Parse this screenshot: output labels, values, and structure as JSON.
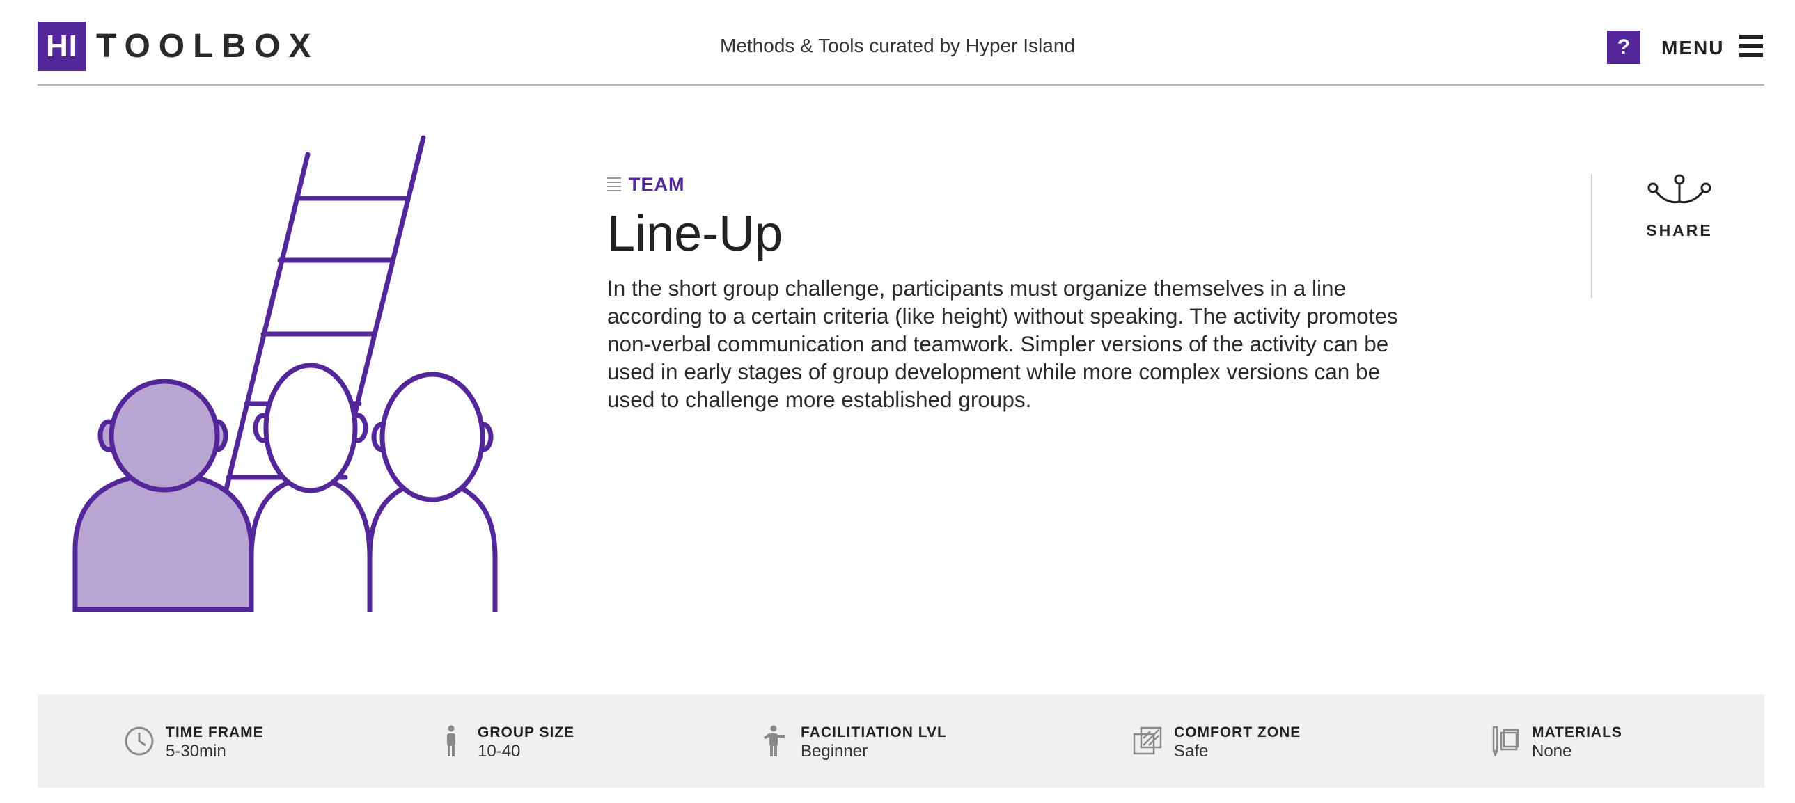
{
  "header": {
    "logo_mark": "HI",
    "logo_text": "TOOLBOX",
    "tagline": "Methods & Tools curated by Hyper Island",
    "help_label": "?",
    "menu_label": "MENU"
  },
  "colors": {
    "brand": "#53269a",
    "brand_light": "#b8a5d1",
    "infobar_bg": "#eff0ef"
  },
  "method": {
    "category": "TEAM",
    "title": "Line-Up",
    "description": "In the short group challenge, participants must organize themselves in a line according to a certain criteria (like height) without speaking. The activity promotes non-verbal communication and teamwork. Simpler versions of the activity can be used in early stages of group development while more complex versions can be used to challenge more established groups."
  },
  "share": {
    "label": "SHARE",
    "icon": "share-icon"
  },
  "info": [
    {
      "icon": "clock-icon",
      "label": "TIME FRAME",
      "value": "5-30min"
    },
    {
      "icon": "person-icon",
      "label": "GROUP SIZE",
      "value": "10-40"
    },
    {
      "icon": "facilitator-icon",
      "label": "FACILITIATION LVL",
      "value": "Beginner"
    },
    {
      "icon": "comfort-zone-icon",
      "label": "COMFORT ZONE",
      "value": "Safe"
    },
    {
      "icon": "materials-icon",
      "label": "MATERIALS",
      "value": "None"
    }
  ]
}
